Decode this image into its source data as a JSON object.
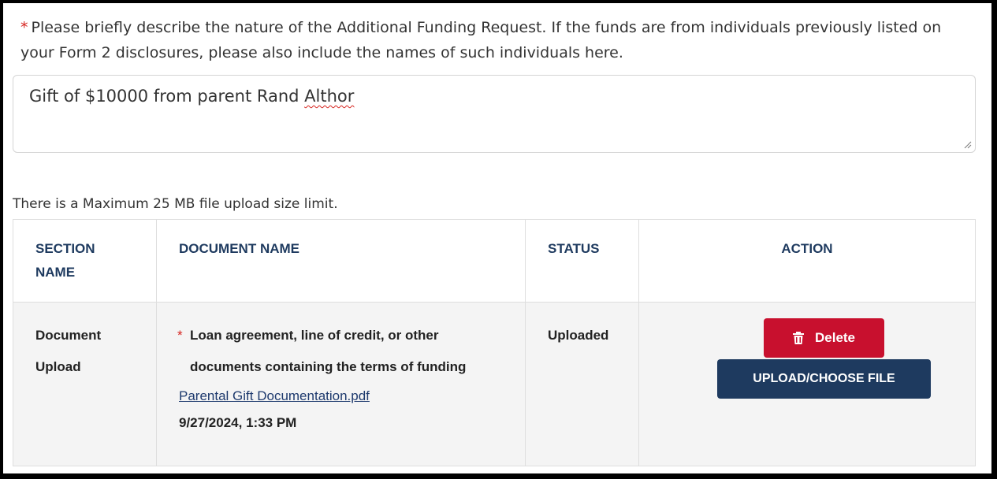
{
  "question": {
    "required_marker": "*",
    "text": "Please briefly describe the nature of the Additional Funding Request. If the funds are from individuals previously listed on your Form 2 disclosures, please also include the names of such individuals here."
  },
  "description_field": {
    "value_prefix": "Gift of $10000 from parent Rand ",
    "value_flagged_word": "Althor"
  },
  "upload_limit_text": "There is a Maximum 25 MB file upload size limit.",
  "table": {
    "headers": {
      "section_name": "SECTION NAME",
      "document_name": "DOCUMENT NAME",
      "status": "STATUS",
      "action": "ACTION"
    },
    "rows": [
      {
        "section_name": "Document Upload",
        "required_marker": "*",
        "document_title": "Loan agreement, line of credit, or other documents containing the terms of funding",
        "file_name": "Parental Gift Documentation.pdf",
        "uploaded_at": "9/27/2024, 1:33 PM",
        "status": "Uploaded",
        "delete_label": "Delete",
        "upload_label": "UPLOAD/CHOOSE FILE"
      }
    ]
  },
  "icons": {
    "delete": "trash-icon",
    "resize": "resize-grip-icon"
  },
  "colors": {
    "required": "#d6241f",
    "header_text": "#1e3a5f",
    "delete_button": "#c8102e",
    "upload_button": "#1e3a5f"
  }
}
